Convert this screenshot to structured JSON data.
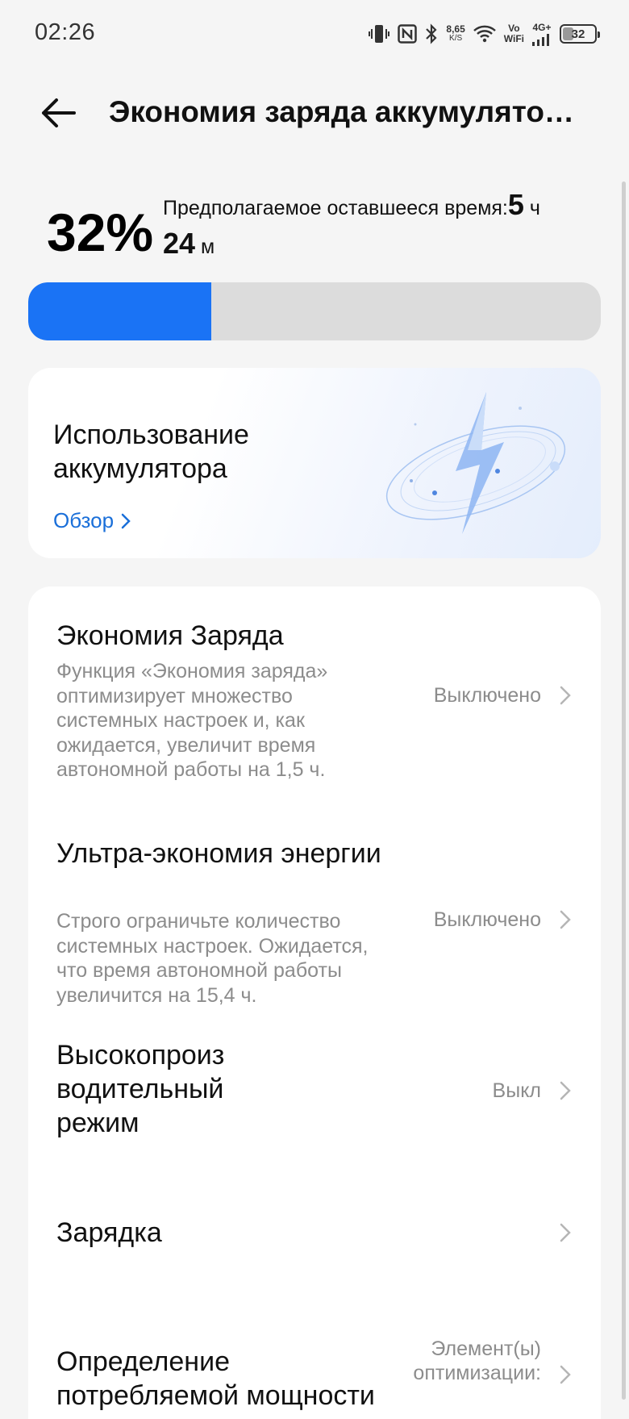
{
  "status_bar": {
    "time": "02:26",
    "net_speed_value": "8,65",
    "net_speed_unit": "K/S",
    "vo_label": "Vo",
    "wifi_label": "WiFi",
    "network_type": "4G+",
    "battery_level": "32",
    "icons": [
      "vibrate-icon",
      "nfc-icon",
      "bluetooth-icon",
      "wifi-icon",
      "signal-icon",
      "battery-icon"
    ]
  },
  "header": {
    "title": "Экономия заряда аккумулято…"
  },
  "battery": {
    "percent": "32%",
    "level_fraction": 0.32,
    "remaining_label": "Предполагаемое оставшееся время:",
    "hours": "5",
    "hours_unit": "ч",
    "minutes": "24",
    "minutes_unit": "м"
  },
  "usage_card": {
    "title": "Использование аккумулятора",
    "link_label": "Обзор"
  },
  "settings": [
    {
      "title": "Экономия Заряда",
      "description": "Функция «Экономия заряда» оптимизирует множество системных настроек и, как ожидается, увеличит время автономной работы на 1,5 ч.",
      "value": "Выключено"
    },
    {
      "title": "Ультра-экономия энергии",
      "description": "Строго ограничьте количество системных настроек. Ожидается, что время автономной работы увеличится на 15,4 ч.",
      "value": "Выключено"
    },
    {
      "title": "Высокопроиз водительный режим",
      "description": "",
      "value": "Выкл"
    },
    {
      "title": "Зарядка",
      "description": "",
      "value": ""
    },
    {
      "title": "Определение потребляемой мощности",
      "description": "",
      "value": "Элемент(ы) оптимизации:"
    }
  ],
  "colors": {
    "accent": "#1a73f5",
    "link": "#1a6fd9",
    "secondary_text": "#8c8c8c",
    "background": "#f5f5f5"
  }
}
